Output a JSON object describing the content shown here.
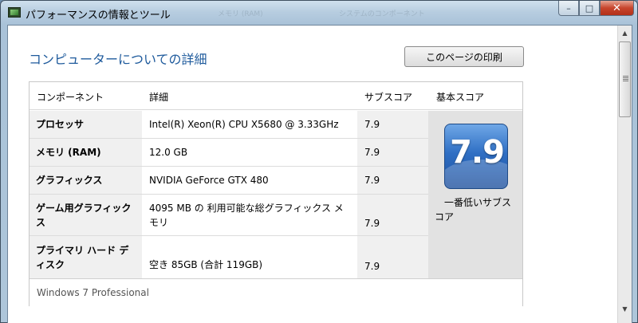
{
  "window": {
    "title": "パフォーマンスの情報とツール",
    "ghost_title_1": "メモリ (RAM)",
    "ghost_title_2": "システムのコンポーネント",
    "min_glyph": "–",
    "max_glyph": "□",
    "close_glyph": "✕"
  },
  "page": {
    "heading": "コンピューターについての詳細",
    "print_button": "このページの印刷"
  },
  "table": {
    "headers": {
      "component": "コンポーネント",
      "detail": "詳細",
      "subscore": "サブスコア",
      "basescore": "基本スコア"
    },
    "rows": [
      {
        "component": "プロセッサ",
        "detail": "Intel(R) Xeon(R) CPU X5680 @ 3.33GHz",
        "subscore": "7.9"
      },
      {
        "component": "メモリ (RAM)",
        "detail": "12.0 GB",
        "subscore": "7.9"
      },
      {
        "component": "グラフィックス",
        "detail": "NVIDIA GeForce GTX 480",
        "subscore": "7.9"
      },
      {
        "component": "ゲーム用グラフィックス",
        "detail": "4095 MB の 利用可能な総グラフィックス メモリ",
        "subscore": "7.9"
      },
      {
        "component": "プライマリ ハード ディスク",
        "detail": "空き 85GB (合計 119GB)",
        "subscore": "7.9"
      }
    ],
    "base_score": "7.9",
    "base_caption": "一番低いサブスコア",
    "footer": "Windows 7 Professional"
  },
  "scrollbar": {
    "up_glyph": "▲",
    "down_glyph": "▼"
  }
}
